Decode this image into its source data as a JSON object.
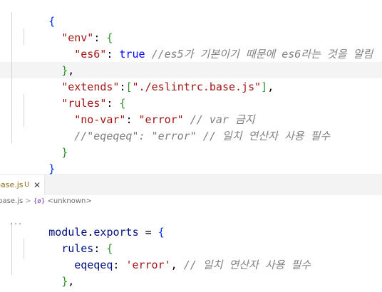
{
  "top_editor": {
    "lines": {
      "l1": {
        "open": "{"
      },
      "l2": {
        "key": "\"env\"",
        "colon": ": ",
        "brace": "{"
      },
      "l3": {
        "key": "\"es6\"",
        "colon": ": ",
        "value": "true",
        "comment": "//es5가 기본이기 때문에 es6라는 것을 알림"
      },
      "l4": {
        "close": "}",
        "comma": ","
      },
      "l5": {
        "key": "\"extends\"",
        "colon": ":",
        "bracket_open": "[",
        "value": "\"./eslintrc.base.js\"",
        "bracket_close": "]",
        "comma": ","
      },
      "l6": {
        "key": "\"rules\"",
        "colon": ": ",
        "brace": "{"
      },
      "l7": {
        "key": "\"no-var\"",
        "colon": ": ",
        "value": "\"error\"",
        "comment": " // var 금지"
      },
      "l8": {
        "comment_key": "//\"eqeqeq\"",
        "comment_colon": ": ",
        "comment_value": "\"error\"",
        "comment": " // 일치 연산자 사용 필수"
      },
      "l9": {
        "close": "}"
      },
      "l10": {
        "close": "}"
      }
    }
  },
  "tab": {
    "label": "base.js",
    "status": "U",
    "close": "✕"
  },
  "breadcrumb": {
    "file": ".base.js",
    "separator": ">",
    "symbol_icon": "{ø}",
    "symbol": "<unknown>"
  },
  "bottom_editor": {
    "lines": {
      "b1": {
        "obj": "module",
        "dot": ".",
        "prop": "exports",
        "op": " = ",
        "brace": "{"
      },
      "b2": {
        "key": "rules",
        "colon": ": ",
        "brace": "{"
      },
      "b3": {
        "key": "eqeqeq",
        "colon": ": ",
        "value": "'error'",
        "comma": ",",
        "comment": " // 일치 연산자 사용 필수"
      },
      "b4": {
        "close": "}",
        "comma": ","
      },
      "b5": {
        "close": "}",
        "semi": ";"
      }
    },
    "fold_dots": "..."
  },
  "colors": {
    "brace_level1": "#0431fa",
    "brace_level2": "#319331",
    "string": "#a31515",
    "json_key": "#0451a5",
    "keyword": "#0000ff",
    "comment": "#008000"
  }
}
